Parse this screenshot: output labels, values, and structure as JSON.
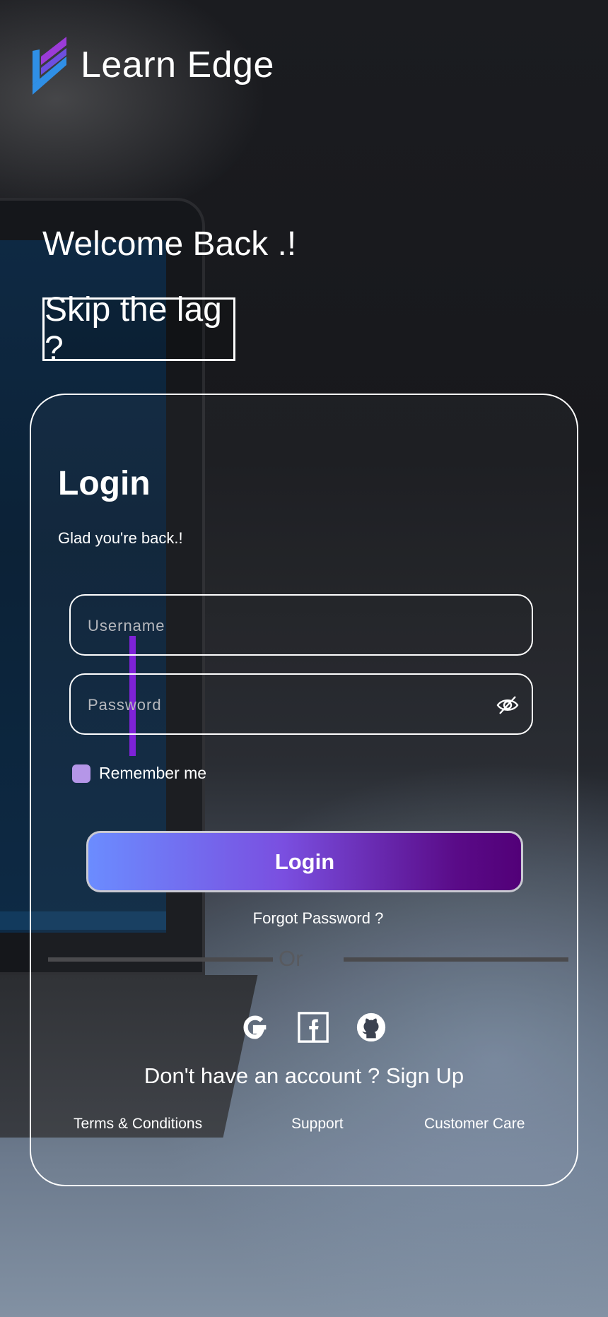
{
  "brand": {
    "name": "Learn Edge"
  },
  "hero": {
    "welcome": "Welcome Back .!",
    "skip_button": "Skip the lag ?"
  },
  "login_card": {
    "title": "Login",
    "subtitle": "Glad you're back.!",
    "username": {
      "placeholder": "Username",
      "value": ""
    },
    "password": {
      "placeholder": "Password",
      "value": "",
      "toggle_icon": "eye-slash-icon"
    },
    "remember_label": "Remember me",
    "remember_checked": false,
    "login_button": "Login",
    "forgot_link": "Forgot Password ?",
    "or_text": "Or",
    "social_icons": [
      "google-icon",
      "facebook-icon",
      "github-icon"
    ],
    "signup_text": "Don't have an account ? Sign Up",
    "footer_links": [
      "Terms & Conditions",
      "Support",
      "Customer Care"
    ]
  },
  "colors": {
    "accent_start": "#6b8cff",
    "accent_end": "#520078",
    "checkbox": "#b596e8"
  }
}
